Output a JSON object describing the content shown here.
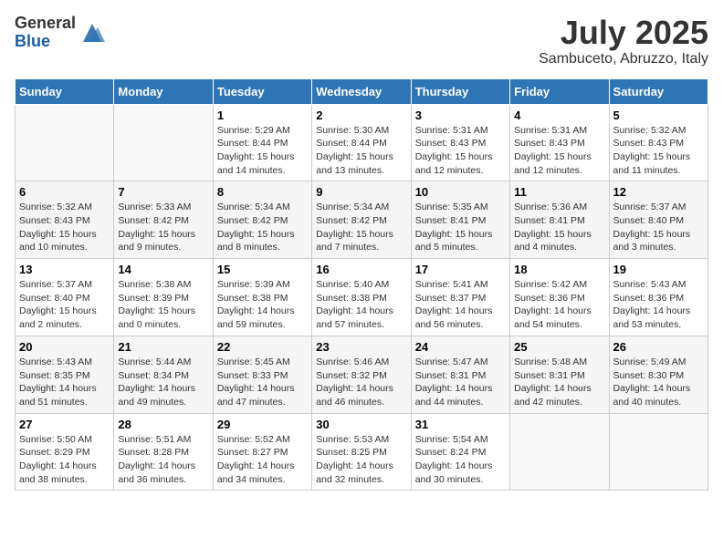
{
  "logo": {
    "general": "General",
    "blue": "Blue"
  },
  "title": {
    "month_year": "July 2025",
    "location": "Sambuceto, Abruzzo, Italy"
  },
  "days_of_week": [
    "Sunday",
    "Monday",
    "Tuesday",
    "Wednesday",
    "Thursday",
    "Friday",
    "Saturday"
  ],
  "weeks": [
    [
      {
        "day": "",
        "info": ""
      },
      {
        "day": "",
        "info": ""
      },
      {
        "day": "1",
        "info": "Sunrise: 5:29 AM\nSunset: 8:44 PM\nDaylight: 15 hours\nand 14 minutes."
      },
      {
        "day": "2",
        "info": "Sunrise: 5:30 AM\nSunset: 8:44 PM\nDaylight: 15 hours\nand 13 minutes."
      },
      {
        "day": "3",
        "info": "Sunrise: 5:31 AM\nSunset: 8:43 PM\nDaylight: 15 hours\nand 12 minutes."
      },
      {
        "day": "4",
        "info": "Sunrise: 5:31 AM\nSunset: 8:43 PM\nDaylight: 15 hours\nand 12 minutes."
      },
      {
        "day": "5",
        "info": "Sunrise: 5:32 AM\nSunset: 8:43 PM\nDaylight: 15 hours\nand 11 minutes."
      }
    ],
    [
      {
        "day": "6",
        "info": "Sunrise: 5:32 AM\nSunset: 8:43 PM\nDaylight: 15 hours\nand 10 minutes."
      },
      {
        "day": "7",
        "info": "Sunrise: 5:33 AM\nSunset: 8:42 PM\nDaylight: 15 hours\nand 9 minutes."
      },
      {
        "day": "8",
        "info": "Sunrise: 5:34 AM\nSunset: 8:42 PM\nDaylight: 15 hours\nand 8 minutes."
      },
      {
        "day": "9",
        "info": "Sunrise: 5:34 AM\nSunset: 8:42 PM\nDaylight: 15 hours\nand 7 minutes."
      },
      {
        "day": "10",
        "info": "Sunrise: 5:35 AM\nSunset: 8:41 PM\nDaylight: 15 hours\nand 5 minutes."
      },
      {
        "day": "11",
        "info": "Sunrise: 5:36 AM\nSunset: 8:41 PM\nDaylight: 15 hours\nand 4 minutes."
      },
      {
        "day": "12",
        "info": "Sunrise: 5:37 AM\nSunset: 8:40 PM\nDaylight: 15 hours\nand 3 minutes."
      }
    ],
    [
      {
        "day": "13",
        "info": "Sunrise: 5:37 AM\nSunset: 8:40 PM\nDaylight: 15 hours\nand 2 minutes."
      },
      {
        "day": "14",
        "info": "Sunrise: 5:38 AM\nSunset: 8:39 PM\nDaylight: 15 hours\nand 0 minutes."
      },
      {
        "day": "15",
        "info": "Sunrise: 5:39 AM\nSunset: 8:38 PM\nDaylight: 14 hours\nand 59 minutes."
      },
      {
        "day": "16",
        "info": "Sunrise: 5:40 AM\nSunset: 8:38 PM\nDaylight: 14 hours\nand 57 minutes."
      },
      {
        "day": "17",
        "info": "Sunrise: 5:41 AM\nSunset: 8:37 PM\nDaylight: 14 hours\nand 56 minutes."
      },
      {
        "day": "18",
        "info": "Sunrise: 5:42 AM\nSunset: 8:36 PM\nDaylight: 14 hours\nand 54 minutes."
      },
      {
        "day": "19",
        "info": "Sunrise: 5:43 AM\nSunset: 8:36 PM\nDaylight: 14 hours\nand 53 minutes."
      }
    ],
    [
      {
        "day": "20",
        "info": "Sunrise: 5:43 AM\nSunset: 8:35 PM\nDaylight: 14 hours\nand 51 minutes."
      },
      {
        "day": "21",
        "info": "Sunrise: 5:44 AM\nSunset: 8:34 PM\nDaylight: 14 hours\nand 49 minutes."
      },
      {
        "day": "22",
        "info": "Sunrise: 5:45 AM\nSunset: 8:33 PM\nDaylight: 14 hours\nand 47 minutes."
      },
      {
        "day": "23",
        "info": "Sunrise: 5:46 AM\nSunset: 8:32 PM\nDaylight: 14 hours\nand 46 minutes."
      },
      {
        "day": "24",
        "info": "Sunrise: 5:47 AM\nSunset: 8:31 PM\nDaylight: 14 hours\nand 44 minutes."
      },
      {
        "day": "25",
        "info": "Sunrise: 5:48 AM\nSunset: 8:31 PM\nDaylight: 14 hours\nand 42 minutes."
      },
      {
        "day": "26",
        "info": "Sunrise: 5:49 AM\nSunset: 8:30 PM\nDaylight: 14 hours\nand 40 minutes."
      }
    ],
    [
      {
        "day": "27",
        "info": "Sunrise: 5:50 AM\nSunset: 8:29 PM\nDaylight: 14 hours\nand 38 minutes."
      },
      {
        "day": "28",
        "info": "Sunrise: 5:51 AM\nSunset: 8:28 PM\nDaylight: 14 hours\nand 36 minutes."
      },
      {
        "day": "29",
        "info": "Sunrise: 5:52 AM\nSunset: 8:27 PM\nDaylight: 14 hours\nand 34 minutes."
      },
      {
        "day": "30",
        "info": "Sunrise: 5:53 AM\nSunset: 8:25 PM\nDaylight: 14 hours\nand 32 minutes."
      },
      {
        "day": "31",
        "info": "Sunrise: 5:54 AM\nSunset: 8:24 PM\nDaylight: 14 hours\nand 30 minutes."
      },
      {
        "day": "",
        "info": ""
      },
      {
        "day": "",
        "info": ""
      }
    ]
  ]
}
